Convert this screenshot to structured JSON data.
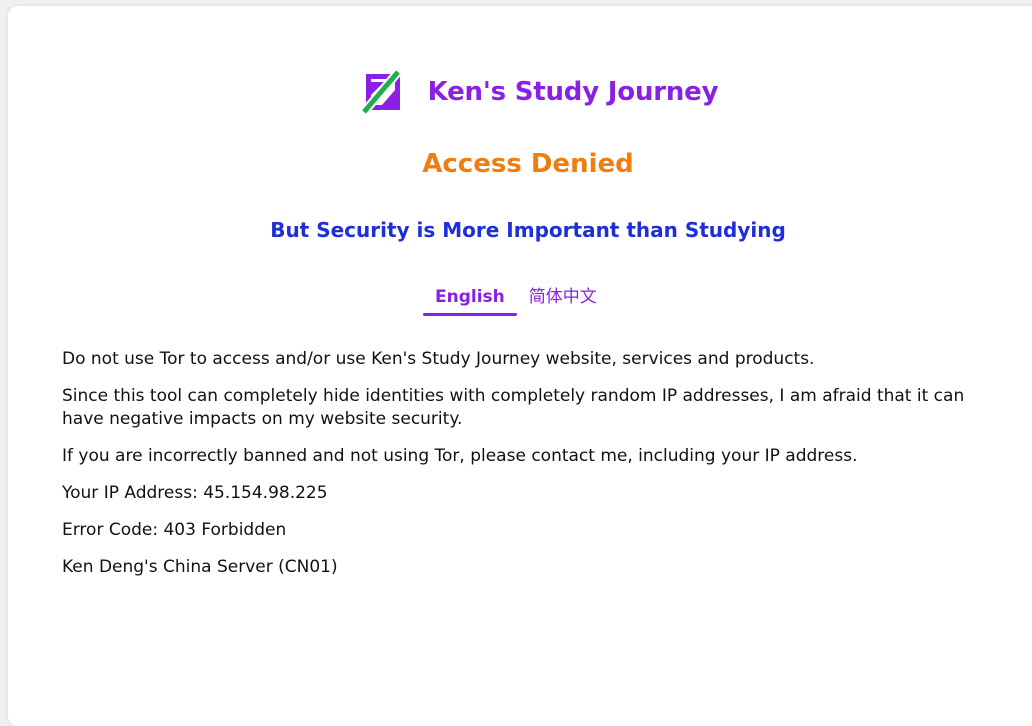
{
  "brand": {
    "title": "Ken's Study Journey",
    "logo_icon": "ksj-logo-icon",
    "color": "#8a1fe6"
  },
  "heading": "Access Denied",
  "subheading": "But Security is More Important than Studying",
  "tabs": [
    {
      "label": "English",
      "active": true
    },
    {
      "label": "简体中文",
      "active": false
    }
  ],
  "content": {
    "p1": "Do not use Tor to access and/or use Ken's Study Journey website, services and products.",
    "p2": "Since this tool can completely hide identities with completely random IP addresses, I am afraid that it can have negative impacts on my website security.",
    "p3": "If you are incorrectly banned and not using Tor, please contact me, including your IP address.",
    "ip_line": "Your IP Address: 45.154.98.225",
    "error_line": "Error Code: 403 Forbidden",
    "server_line": "Ken Deng's China Server (CN01)"
  },
  "colors": {
    "brand_purple": "#8a1fe6",
    "heading_orange": "#f07d0f",
    "subheading_blue": "#1d2fd6",
    "logo_green": "#1fb04b"
  }
}
